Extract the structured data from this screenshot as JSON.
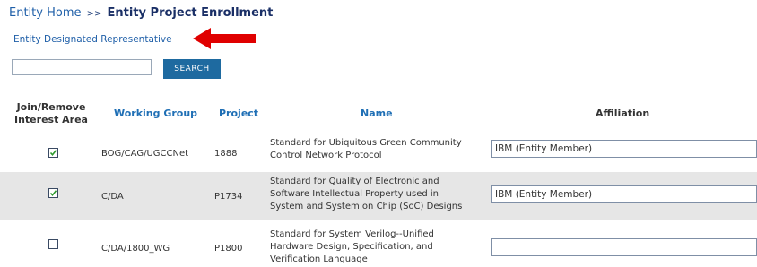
{
  "breadcrumb": {
    "home": "Entity Home",
    "separator": ">>",
    "current": "Entity Project Enrollment"
  },
  "designated_rep_link": "Entity Designated Representative",
  "search": {
    "value": "",
    "button_label": "SEARCH"
  },
  "colors": {
    "link": "#1f5fa8",
    "header_blue": "#1f6fb5",
    "button": "#1e6aa0",
    "arrow": "#e00000",
    "row_alt": "#e6e6e6"
  },
  "table": {
    "headers": {
      "join_line1": "Join/Remove",
      "join_line2": "Interest Area",
      "working_group": "Working Group",
      "project": "Project",
      "name": "Name",
      "affiliation": "Affiliation"
    },
    "rows": [
      {
        "checked": true,
        "working_group": "BOG/CAG/UGCCNet",
        "project": "1888",
        "name_lines": [
          "Standard for Ubiquitous Green Community",
          "Control Network Protocol"
        ],
        "affiliation": "IBM (Entity Member)"
      },
      {
        "checked": true,
        "working_group": "C/DA",
        "project": "P1734",
        "name_lines": [
          "Standard for Quality of Electronic and",
          "Software Intellectual Property used in",
          "System and System on Chip (SoC) Designs"
        ],
        "affiliation": "IBM (Entity Member)"
      },
      {
        "checked": false,
        "working_group": "C/DA/1800_WG",
        "project": "P1800",
        "name_lines": [
          "Standard for System Verilog--Unified",
          "Hardware Design, Specification, and",
          "Verification Language"
        ],
        "affiliation": ""
      }
    ]
  }
}
